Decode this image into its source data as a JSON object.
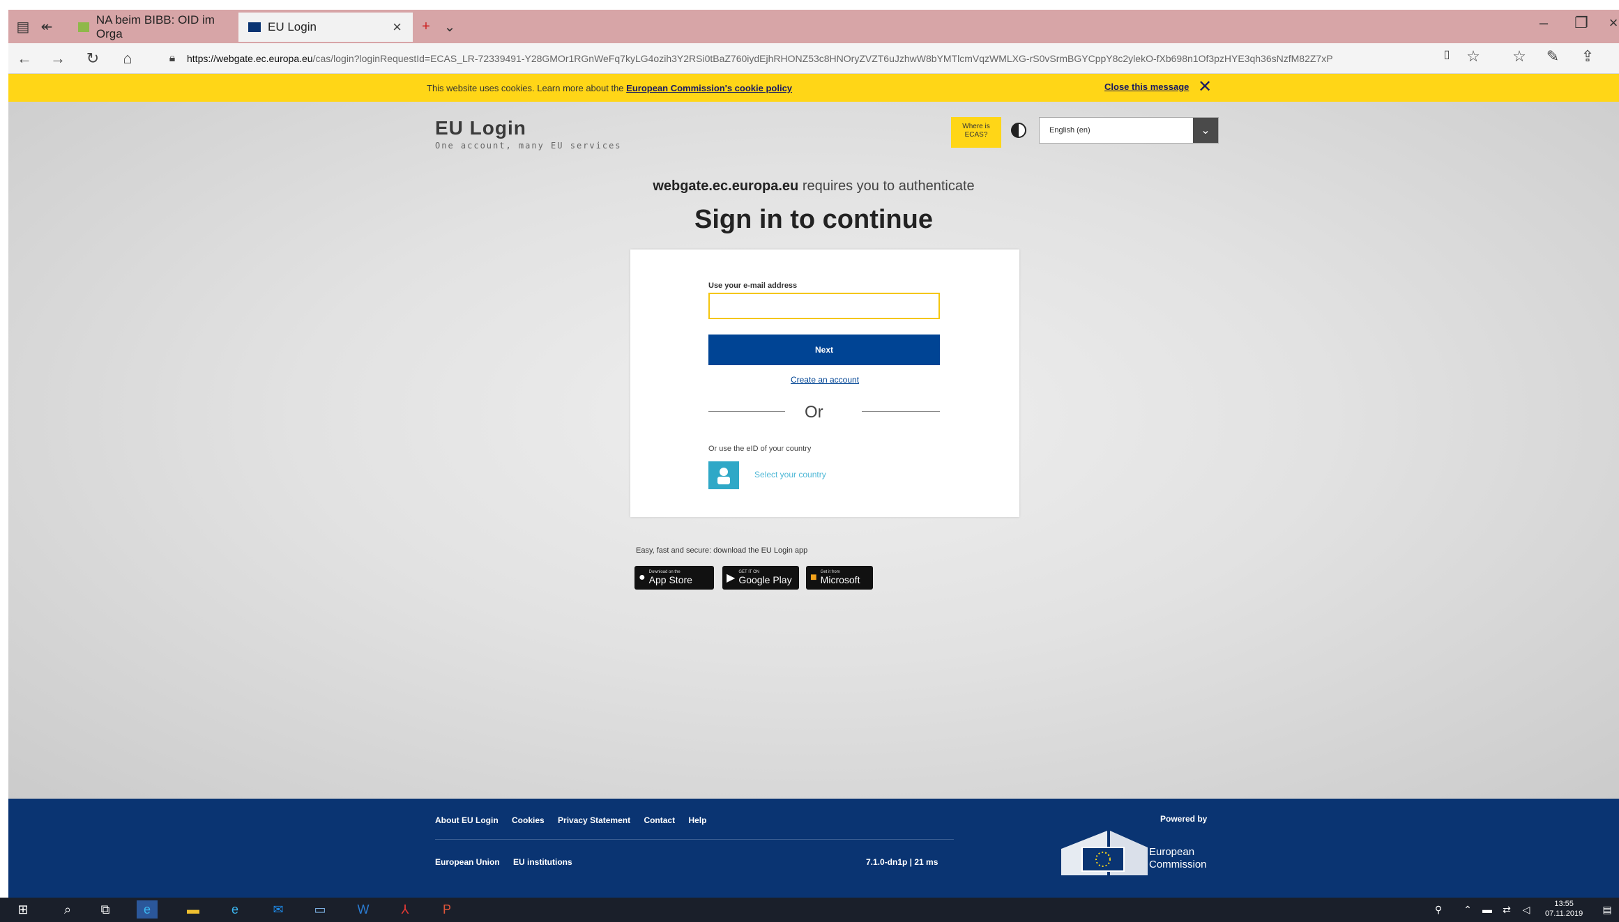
{
  "browser": {
    "tabs": [
      {
        "label": "NA beim BIBB: OID im Orga",
        "active": false
      },
      {
        "label": "EU Login",
        "active": true
      }
    ],
    "new_tab_glyph": "+",
    "tab_dropdown_glyph": "⌄",
    "url_host": "https://webgate.ec.europa.eu",
    "url_path": "/cas/login?loginRequestId=ECAS_LR-72339491-Y28GMOr1RGnWeFq7kyLG4ozih3Y2RSi0tBaZ760iydEjhRHONZ53c8HNOryZVZT6uJzhwW8bYMTlcmVqzWMLXG-rS0vSrmBGYCppY8c2ylekO-fXb698n1Of3pzHYE3qh36sNzfM82Z7xP",
    "icons": [
      "back-icon",
      "forward-icon",
      "refresh-icon",
      "home-icon",
      "lock-icon",
      "reading-view-icon",
      "favorite-icon",
      "favorites-hub-icon",
      "pen-icon",
      "share-icon"
    ]
  },
  "cookie_banner": {
    "message": "This website uses cookies. Learn more about the ",
    "link": "European Commission's cookie policy",
    "close": "Close this message"
  },
  "header": {
    "title": "EU Login",
    "tagline": "One account, many EU services",
    "ecas_badge": "Where is ECAS?",
    "language": "English (en)"
  },
  "main": {
    "domain": "webgate.ec.europa.eu",
    "requires_text": " requires you to authenticate",
    "title": "Sign in to continue",
    "email_label": "Use your e-mail address",
    "email_value": "",
    "next_label": "Next",
    "create_account": "Create an account",
    "or": "Or",
    "eid_text": "Or use the eID of your country",
    "select_country": "Select your country",
    "app_text": "Easy, fast and secure: download the EU Login app",
    "stores": [
      {
        "sub": "Download on the",
        "main": "App Store",
        "glyph": ""
      },
      {
        "sub": "GET IT ON",
        "main": "Google Play",
        "glyph": "▶"
      },
      {
        "sub": "Get it from",
        "main": "Microsoft",
        "glyph": "■"
      }
    ]
  },
  "footer": {
    "links": [
      "About EU Login",
      "Cookies",
      "Privacy Statement",
      "Contact",
      "Help"
    ],
    "bottom_links": [
      "European Union",
      "EU institutions"
    ],
    "version": "7.1.0-dn1p | 21 ms",
    "powered_by": "Powered by",
    "org_line1": "European",
    "org_line2": "Commission"
  },
  "taskbar": {
    "time": "13:55",
    "date": "07.11.2019"
  },
  "colors": {
    "accent_yellow": "#ffd617",
    "ec_blue": "#004494",
    "footer_blue": "#0a3472",
    "eid_teal": "#2fa8c7"
  }
}
